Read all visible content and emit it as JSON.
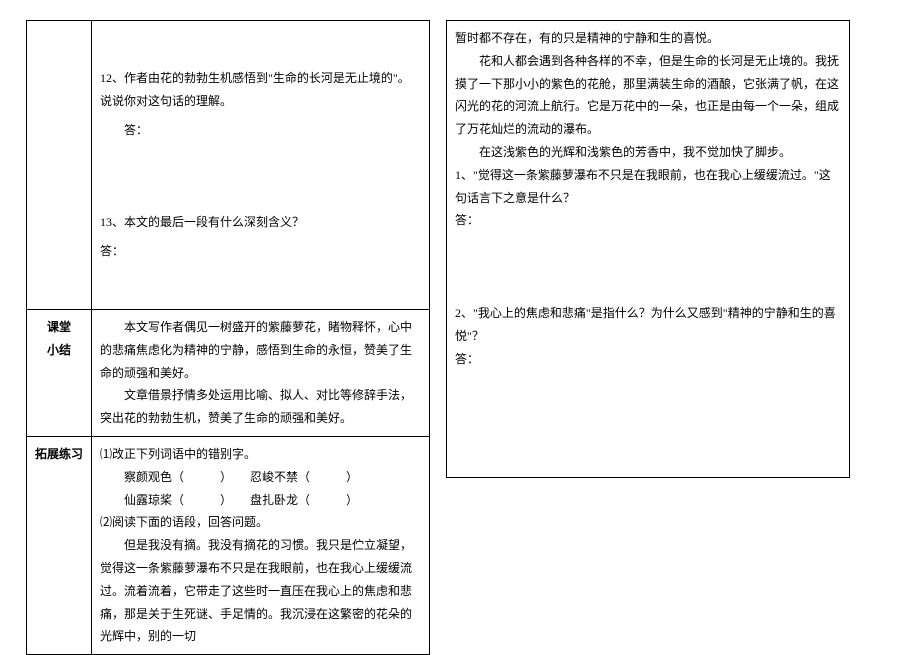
{
  "left": {
    "section_top": {
      "q12": "12、作者由花的勃勃生机感悟到\"生命的长河是无止境的\"。说说你对这句话的理解。",
      "ans_label_a": "答：",
      "q13": "13、本文的最后一段有什么深刻含义？",
      "ans_label_b": "答："
    },
    "summary": {
      "label_l1": "课堂",
      "label_l2": "小结",
      "p1": "本文写作者偶见一树盛开的紫藤萝花，睹物释怀，心中的悲痛焦虑化为精神的宁静，感悟到生命的永恒，赞美了生命的顽强和美好。",
      "p2": "文章借景抒情多处运用比喻、拟人、对比等修辞手法，突出花的勃勃生机，赞美了生命的顽强和美好。"
    },
    "extend": {
      "label_l1": "拓展练习",
      "t1": "⑴改正下列词语中的错别字。",
      "w1a": "察颜观色（",
      "w1b": "忍峻不禁（",
      "w2a": "仙露琼桨（",
      "w2b": "盘扎卧龙（",
      "close": "）",
      "t2": "⑵阅读下面的语段，回答问题。",
      "para": "但是我没有摘。我没有摘花的习惯。我只是伫立凝望，觉得这一条紫藤萝瀑布不只是在我眼前，也在我心上缓缓流过。流着流着，它带走了这些时一直压在我心上的焦虑和悲痛，那是关于生死谜、手足情的。我沉浸在这繁密的花朵的光辉中，别的一切"
    }
  },
  "right": {
    "cont": {
      "p0": "暂时都不存在，有的只是精神的宁静和生的喜悦。",
      "p1": "花和人都会遇到各种各样的不幸，但是生命的长河是无止境的。我抚摸了一下那小小的紫色的花舱，那里满装生命的酒酿，它张满了帆，在这闪光的花的河流上航行。它是万花中的一朵，也正是由每一个一朵，组成了万花灿烂的流动的瀑布。",
      "p2": "在这浅紫色的光辉和浅紫色的芳香中，我不觉加快了脚步。"
    },
    "q1": "1、\"觉得这一条紫藤萝瀑布不只是在我眼前，也在我心上缓缓流过。\"这句话言下之意是什么？",
    "ans1": "答：",
    "q2": "2、\"我心上的焦虑和悲痛\"是指什么？为什么又感到\"精神的宁静和生的喜悦\"？",
    "ans2": "答："
  }
}
